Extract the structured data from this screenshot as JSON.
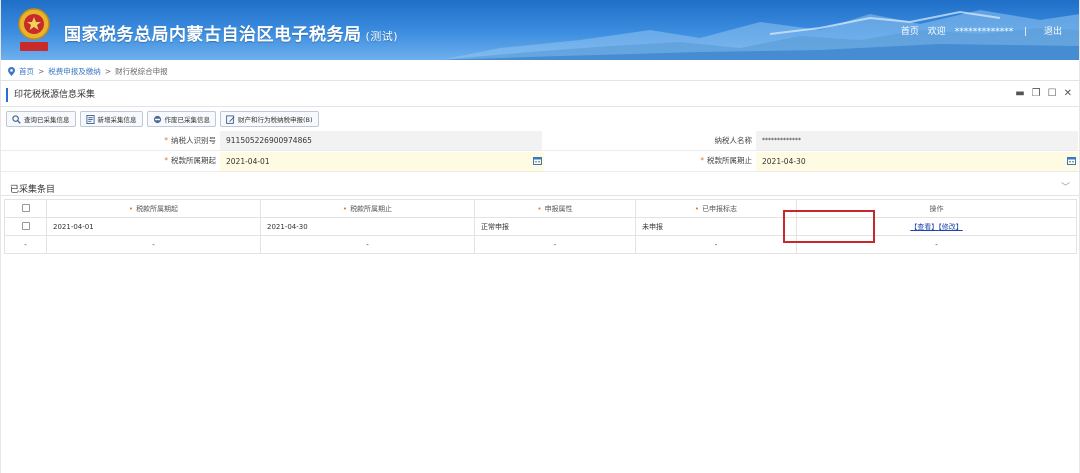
{
  "header": {
    "title": "国家税务总局内蒙古自治区电子税务局",
    "tag": "(测试)",
    "home": "首页",
    "welcome": "欢迎",
    "username": "*************",
    "separator": "|",
    "logout": "退出",
    "emblem_text": "中国税务"
  },
  "breadcrumb": {
    "items": [
      "首页",
      "税费申报及缴纳",
      "财行税综合申报"
    ],
    "sep": ">"
  },
  "panel": {
    "title": "印花税税源信息采集",
    "toolbar": [
      {
        "label": "查询已采集信息",
        "icon": "search-icon"
      },
      {
        "label": "新增采集信息",
        "icon": "document-icon"
      },
      {
        "label": "作废已采集信息",
        "icon": "void-icon"
      },
      {
        "label": "财产和行为税纳税申报(B)",
        "icon": "edit-icon"
      }
    ]
  },
  "form": {
    "taxpayer_id_label": "纳税人识别号",
    "taxpayer_id": "911505226900974865",
    "taxpayer_name_label": "纳税人名称",
    "taxpayer_name": "*************",
    "period_start_label": "税款所属期起",
    "period_start": "2021-04-01",
    "period_end_label": "税款所属期止",
    "period_end": "2021-04-30",
    "required_mark": "*"
  },
  "table": {
    "section_title": "已采集条目",
    "headers": [
      "税款所属期起",
      "税款所属期止",
      "申报属性",
      "已申报标志",
      "操作"
    ],
    "rows": [
      {
        "start": "2021-04-01",
        "end": "2021-04-30",
        "attr": "正常申报",
        "flag": "未申报",
        "view": "【查看】",
        "modify": "【修改】"
      }
    ],
    "empty_row": [
      "-",
      "-",
      "-",
      "-",
      "-",
      "-"
    ]
  },
  "colors": {
    "header_blue": "#2a75cc",
    "accent": "#2a6fc9",
    "required": "#e0772a",
    "highlight": "#c8282d"
  }
}
